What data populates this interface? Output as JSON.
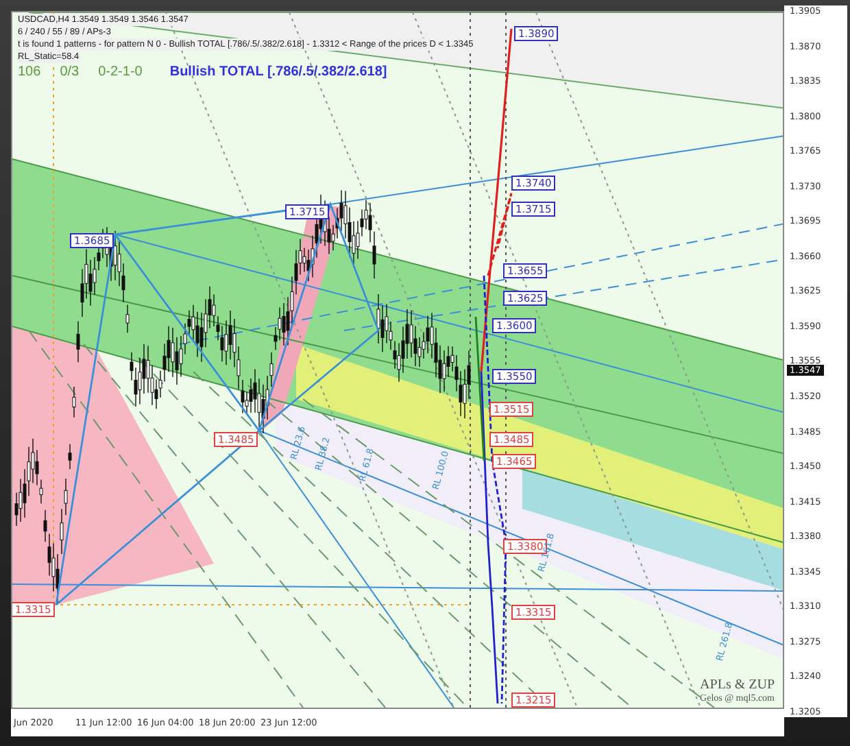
{
  "header": {
    "symbol_line": "USDCAD,H4  1.3549 1.3549 1.3546 1.3547",
    "settings_line": "6 / 240 / 55 / 89 / APs-3",
    "pattern_line": "t is found 1 patterns  -  for pattern N 0 - Bullish TOTAL [.786/.5/.382/2.618] - 1.3312 < Range of the prices D < 1.3345",
    "static_line": "RL_Static=58.4"
  },
  "stats": [
    {
      "text": "106",
      "kind": "count"
    },
    {
      "text": "0/3",
      "kind": "count"
    },
    {
      "text": "0-2-1-0",
      "kind": "count"
    },
    {
      "text": "Bullish TOTAL [.786/.5/.382/2.618]",
      "kind": "pattern"
    }
  ],
  "price_tags": [
    {
      "text": "1.3890",
      "color": "#3030c0"
    },
    {
      "text": "1.3740",
      "color": "#3030c0"
    },
    {
      "text": "1.3715",
      "color": "#3030c0"
    },
    {
      "text": "1.3715",
      "color": "#3030c0"
    },
    {
      "text": "1.3685",
      "color": "#3030c0"
    },
    {
      "text": "1.3655",
      "color": "#3030c0"
    },
    {
      "text": "1.3625",
      "color": "#3030c0"
    },
    {
      "text": "1.3600",
      "color": "#3030c0"
    },
    {
      "text": "1.3550",
      "color": "#3030c0"
    },
    {
      "text": "1.3515",
      "color": "#e04040"
    },
    {
      "text": "1.3485",
      "color": "#e04040"
    },
    {
      "text": "1.3485",
      "color": "#e04040"
    },
    {
      "text": "1.3465",
      "color": "#e04040"
    },
    {
      "text": "1.3380",
      "color": "#e04040"
    },
    {
      "text": "1.3315",
      "color": "#e04040"
    },
    {
      "text": "1.3315",
      "color": "#e04040"
    },
    {
      "text": "1.3215",
      "color": "#e04040"
    }
  ],
  "fibo_labels": [
    "RL 23.6",
    "RL 38.2",
    "RL 61.8",
    "RL 100.0",
    "RL 161.8",
    "RL 261.8"
  ],
  "signature": {
    "title": "APLs & ZUP",
    "author": "Gelos @ mql5.com"
  },
  "price_scale": [
    "1.3905",
    "1.3870",
    "1.3835",
    "1.3800",
    "1.3765",
    "1.3730",
    "1.3695",
    "1.3660",
    "1.3625",
    "1.3590",
    "1.3555",
    "1.3520",
    "1.3485",
    "1.3450",
    "1.3415",
    "1.3380",
    "1.3345",
    "1.3310",
    "1.3275",
    "1.3240",
    "1.3205"
  ],
  "current_price": "1.3547",
  "time_axis": [
    "Jun 2020",
    "11 Jun 12:00",
    "16 Jun 04:00",
    "18 Jun 20:00",
    "23 Jun 12:00"
  ]
}
